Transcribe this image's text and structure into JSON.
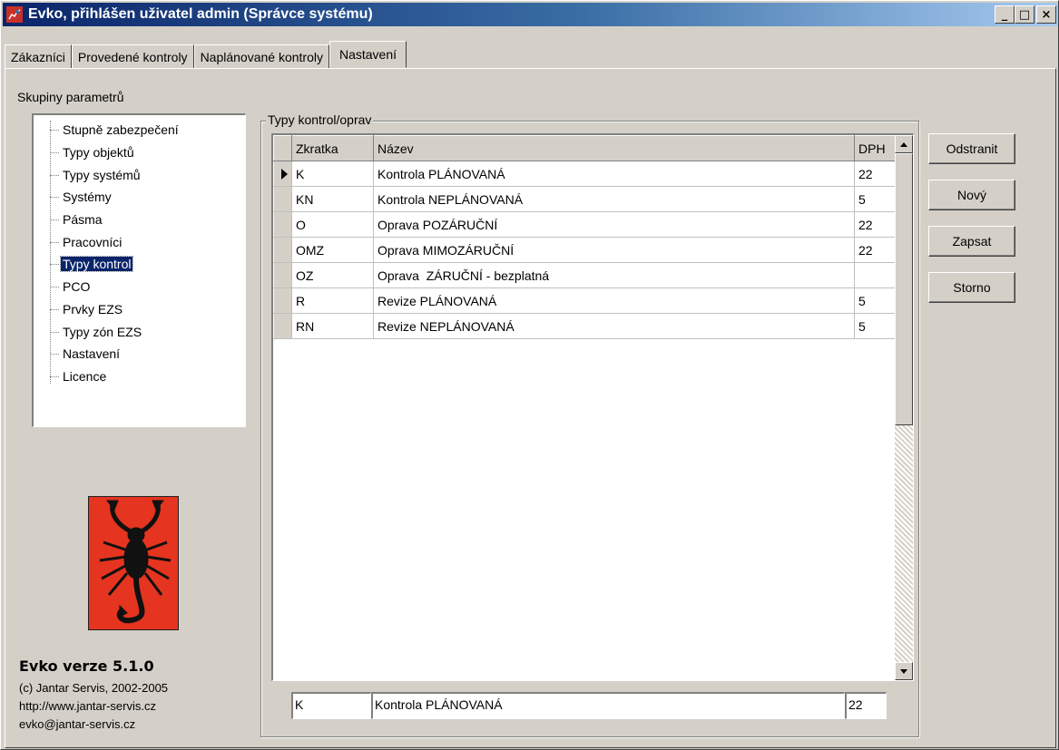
{
  "window": {
    "title": "Evko, přihlášen uživatel admin (Správce systému)",
    "controls": {
      "minimize": "_",
      "maximize": "□",
      "close": "×"
    }
  },
  "tabs": [
    "Zákazníci",
    "Provedené kontroly",
    "Naplánované kontroly",
    "Nastavení"
  ],
  "active_tab": "Nastavení",
  "sidebar": {
    "heading": "Skupiny parametrů",
    "items": [
      "Stupně zabezpečení",
      "Typy objektů",
      "Typy systémů",
      "Systémy",
      "Pásma",
      "Pracovníci",
      "Typy kontrol",
      "PCO",
      "Prvky EZS",
      "Typy zón EZS",
      "Nastavení",
      "Licence"
    ],
    "selected": "Typy kontrol"
  },
  "about": {
    "version": "Evko verze 5.1.0",
    "copyright": "(c) Jantar Servis, 2002-2005",
    "web": "http://www.jantar-servis.cz",
    "email": "evko@jantar-servis.cz"
  },
  "group": {
    "title": "Typy kontrol/oprav",
    "columns": [
      "Zkratka",
      "Název",
      "DPH"
    ],
    "rows": [
      [
        "K",
        "Kontrola PLÁNOVANÁ",
        "22"
      ],
      [
        "KN",
        "Kontrola NEPLÁNOVANÁ",
        "5"
      ],
      [
        "O",
        "Oprava POZÁRUČNÍ",
        "22"
      ],
      [
        "OMZ",
        "Oprava MIMOZÁRUČNÍ",
        "22"
      ],
      [
        "OZ",
        "Oprava  ZÁRUČNÍ - bezplatná",
        ""
      ],
      [
        "R",
        "Revize PLÁNOVANÁ",
        "5"
      ],
      [
        "RN",
        "Revize NEPLÁNOVANÁ",
        "5"
      ]
    ],
    "current_row": 0
  },
  "edit": {
    "zkratka": "K",
    "nazev": "Kontrola PLÁNOVANÁ",
    "dph": "22"
  },
  "buttons": {
    "delete": "Odstranit",
    "new": "Nový",
    "save": "Zapsat",
    "cancel": "Storno"
  },
  "colors": {
    "titlebar_start": "#0a246a",
    "titlebar_end": "#a6caf0",
    "face": "#d4d0c8",
    "selection": "#0a246a",
    "logo_bg": "#e5341f"
  }
}
